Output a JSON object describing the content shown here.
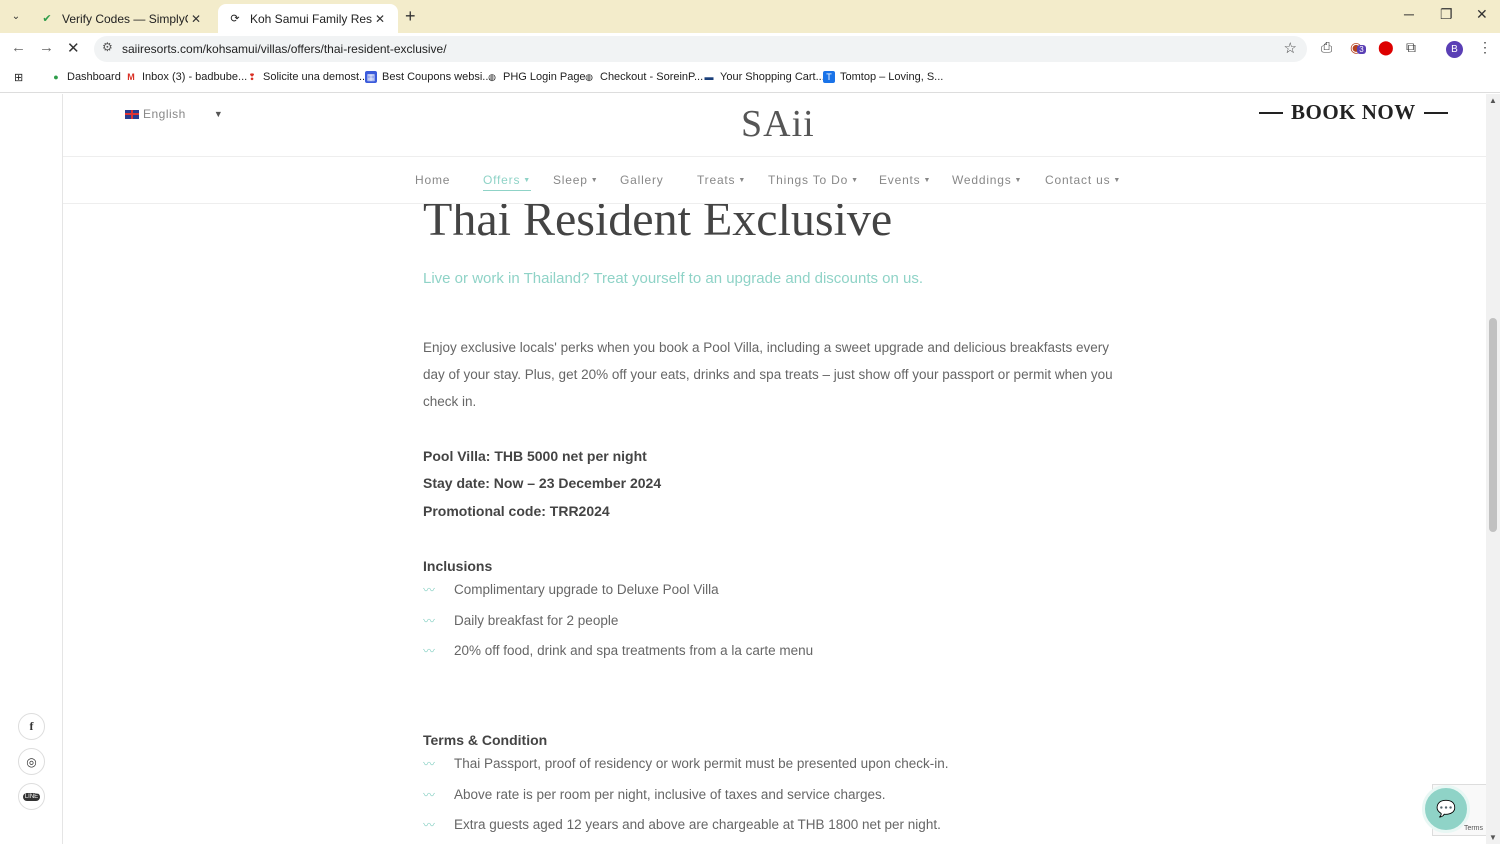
{
  "browser": {
    "tabs": [
      {
        "title": "Verify Codes — SimplyCodes",
        "icon": "simplycodes-icon"
      },
      {
        "title": "Koh Samui Family Resort | Thai",
        "icon": "loading-icon"
      }
    ],
    "url": "saiiresorts.com/kohsamui/villas/offers/thai-resident-exclusive/",
    "profile_initial": "B",
    "extension_badge": "3",
    "bookmarks": [
      {
        "label": "Dashboard",
        "icon": "dashboard-icon",
        "color": "#2e9d4a"
      },
      {
        "label": "Inbox (3) - badbube...",
        "icon": "gmail-icon",
        "color": "#d93025"
      },
      {
        "label": "Solicite una demost...",
        "icon": "pin-icon",
        "color": "#d93025"
      },
      {
        "label": "Best Coupons websi...",
        "icon": "grid-icon",
        "color": "#3b5bdb"
      },
      {
        "label": "PHG Login Page",
        "icon": "globe-icon",
        "color": "#333333"
      },
      {
        "label": "Checkout - SoreinP...",
        "icon": "globe-icon",
        "color": "#333333"
      },
      {
        "label": "Your Shopping Cart...",
        "icon": "cart-icon",
        "color": "#1a3f7a"
      },
      {
        "label": "Tomtop – Loving, S...",
        "icon": "tomtop-icon",
        "color": "#1a73e8"
      }
    ]
  },
  "site": {
    "language": "English",
    "logo": "SAii",
    "book_now": "BOOK NOW",
    "nav": [
      {
        "label": "Home",
        "dropdown": false,
        "active": false
      },
      {
        "label": "Offers",
        "dropdown": true,
        "active": true
      },
      {
        "label": "Sleep",
        "dropdown": true,
        "active": false
      },
      {
        "label": "Gallery",
        "dropdown": false,
        "active": false
      },
      {
        "label": "Treats",
        "dropdown": true,
        "active": false
      },
      {
        "label": "Things To Do",
        "dropdown": true,
        "active": false
      },
      {
        "label": "Events",
        "dropdown": true,
        "active": false
      },
      {
        "label": "Weddings",
        "dropdown": true,
        "active": false
      },
      {
        "label": "Contact us",
        "dropdown": true,
        "active": false
      }
    ],
    "accent_color": "#8fd3c7"
  },
  "offer": {
    "title": "Thai Resident Exclusive",
    "subtitle": "Live or work in Thailand? Treat yourself to an upgrade and discounts on us.",
    "intro": "Enjoy exclusive locals' perks when you book a Pool Villa, including a sweet upgrade and delicious breakfasts every day of your stay. Plus, get 20% off your eats, drinks and spa treats – just show off your passport or permit when you check in.",
    "details": [
      "Pool Villa: THB 5000 net per night",
      "Stay date: Now – 23 December 2024",
      "Promotional code: TRR2024"
    ],
    "inclusions_heading": "Inclusions",
    "inclusions": [
      "Complimentary upgrade to Deluxe Pool Villa",
      "Daily breakfast for 2 people",
      "20% off food, drink and spa treatments from a la carte menu"
    ],
    "terms_heading": "Terms & Condition",
    "terms": [
      "Thai Passport, proof of residency or work permit must be presented upon check-in.",
      "Above rate is per room per night, inclusive of taxes and service charges.",
      "Extra guests aged 12 years and above are chargeable at THB 1800 net per night."
    ]
  },
  "social": [
    "facebook-icon",
    "instagram-icon",
    "line-icon"
  ],
  "recaptcha_text": "Terms"
}
